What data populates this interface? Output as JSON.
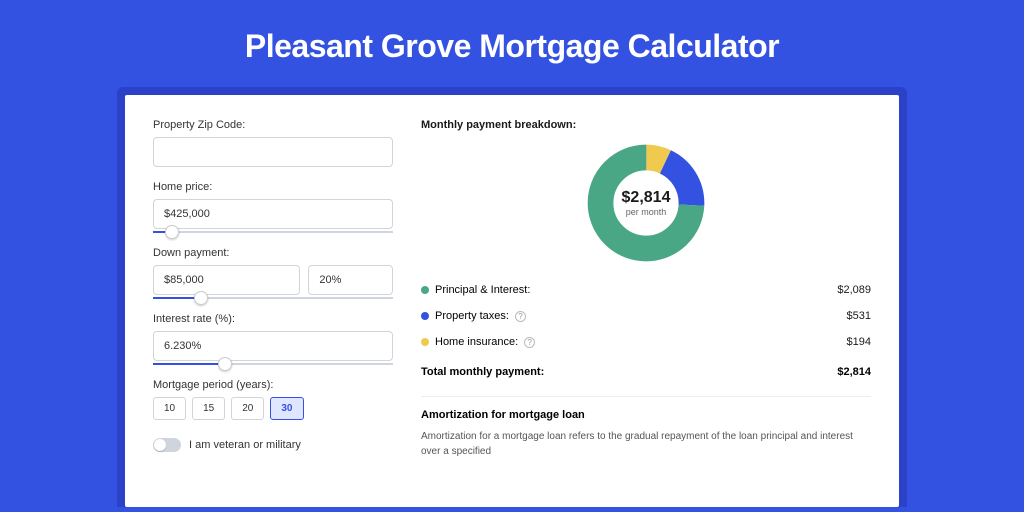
{
  "title": "Pleasant Grove Mortgage Calculator",
  "form": {
    "zip_label": "Property Zip Code:",
    "zip_value": "",
    "home_price_label": "Home price:",
    "home_price_value": "$425,000",
    "home_price_slider_pct": 8,
    "down_payment_label": "Down payment:",
    "down_payment_value": "$85,000",
    "down_payment_pct": "20%",
    "down_payment_slider_pct": 20,
    "interest_label": "Interest rate (%):",
    "interest_value": "6.230%",
    "interest_slider_pct": 30,
    "period_label": "Mortgage period (years):",
    "periods": [
      {
        "label": "10",
        "active": false
      },
      {
        "label": "15",
        "active": false
      },
      {
        "label": "20",
        "active": false
      },
      {
        "label": "30",
        "active": true
      }
    ],
    "veteran_label": "I am veteran or military"
  },
  "breakdown": {
    "title": "Monthly payment breakdown:",
    "center_amount": "$2,814",
    "center_sub": "per month",
    "items": [
      {
        "key": "principal",
        "color": "#4aa785",
        "label": "Principal & Interest:",
        "help": false,
        "value": "$2,089"
      },
      {
        "key": "taxes",
        "color": "#3452e1",
        "label": "Property taxes:",
        "help": true,
        "value": "$531"
      },
      {
        "key": "insurance",
        "color": "#f0c94f",
        "label": "Home insurance:",
        "help": true,
        "value": "$194"
      }
    ],
    "total_label": "Total monthly payment:",
    "total_value": "$2,814"
  },
  "amortization": {
    "title": "Amortization for mortgage loan",
    "text": "Amortization for a mortgage loan refers to the gradual repayment of the loan principal and interest over a specified"
  },
  "chart_data": {
    "type": "pie",
    "title": "Monthly payment breakdown",
    "total": 2814,
    "unit": "USD per month",
    "series": [
      {
        "name": "Principal & Interest",
        "value": 2089,
        "color": "#4aa785"
      },
      {
        "name": "Property taxes",
        "value": 531,
        "color": "#3452e1"
      },
      {
        "name": "Home insurance",
        "value": 194,
        "color": "#f0c94f"
      }
    ]
  },
  "colors": {
    "primary": "#3452e1",
    "green": "#4aa785",
    "yellow": "#f0c94f"
  }
}
